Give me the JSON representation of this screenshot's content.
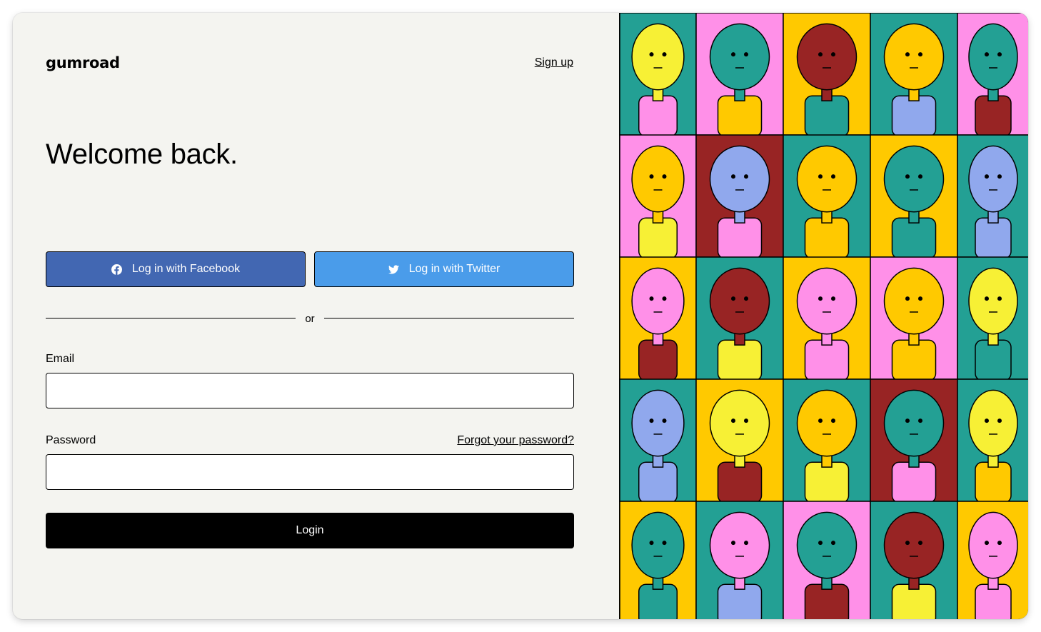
{
  "brand": {
    "logo_text": "Gumroad"
  },
  "header": {
    "signup_label": "Sign up"
  },
  "main": {
    "heading": "Welcome back.",
    "facebook_button": "Log in with Facebook",
    "twitter_button": "Log in with Twitter",
    "divider_text": "or",
    "email_label": "Email",
    "email_value": "",
    "password_label": "Password",
    "password_value": "",
    "forgot_link": "Forgot your password?",
    "login_button": "Login"
  },
  "icons": {
    "facebook": "facebook-icon",
    "twitter": "twitter-icon"
  },
  "colors": {
    "background": "#f4f4f0",
    "facebook": "#4267b2",
    "twitter": "#4a9cea",
    "login": "#000000",
    "tile_palette": [
      "#f7f035",
      "#ff90e8",
      "#ffc900",
      "#23a094",
      "#90a8ed",
      "#982424"
    ]
  },
  "illustration": {
    "grid": [
      [
        "#23a094",
        "#ff90e8",
        "#ffc900",
        "#23a094",
        "#ff90e8"
      ],
      [
        "#ff90e8",
        "#982424",
        "#23a094",
        "#ffc900",
        "#23a094"
      ],
      [
        "#ffc900",
        "#23a094",
        "#ffc900",
        "#ff90e8",
        "#23a094"
      ],
      [
        "#23a094",
        "#ffc900",
        "#23a094",
        "#982424",
        "#23a094"
      ],
      [
        "#ffc900",
        "#23a094",
        "#ff90e8",
        "#23a094",
        "#ffc900"
      ]
    ],
    "figures": [
      [
        "#f7f035",
        "#23a094",
        "#982424",
        "#ffc900",
        "#23a094"
      ],
      [
        "#ffc900",
        "#90a8ed",
        "#ffc900",
        "#23a094",
        "#90a8ed"
      ],
      [
        "#ff90e8",
        "#982424",
        "#ff90e8",
        "#ffc900",
        "#f7f035"
      ],
      [
        "#90a8ed",
        "#f7f035",
        "#ffc900",
        "#23a094",
        "#f7f035"
      ],
      [
        "#23a094",
        "#ff90e8",
        "#23a094",
        "#982424",
        "#ff90e8"
      ]
    ]
  }
}
